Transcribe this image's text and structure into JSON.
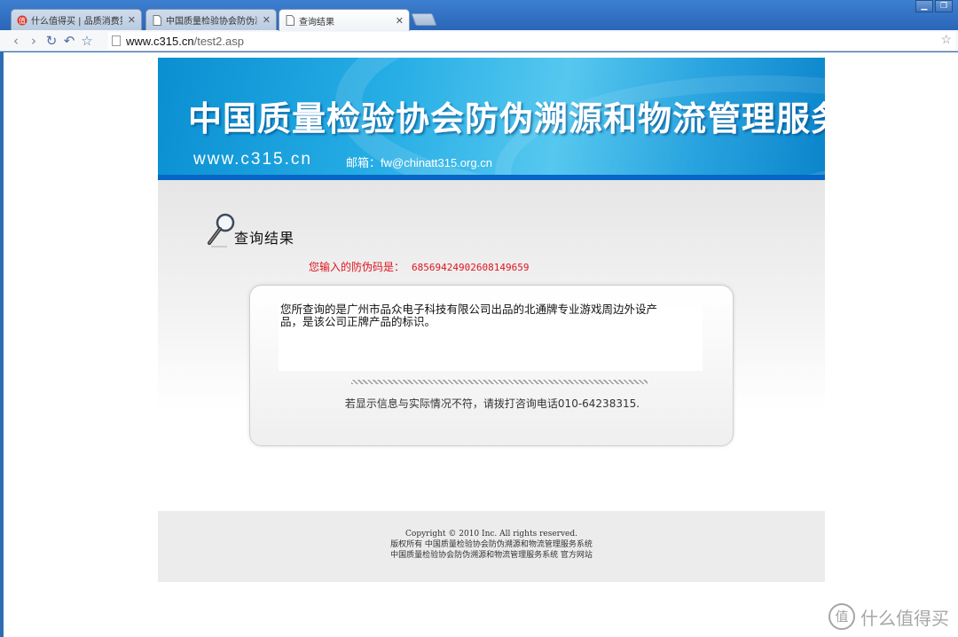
{
  "browser": {
    "tabs": [
      {
        "title": "什么值得买 | 品质消费第一",
        "active": false
      },
      {
        "title": "中国质量检验协会防伪溯源",
        "active": false
      },
      {
        "title": "查询结果",
        "active": true
      }
    ],
    "address": {
      "host": "www.c315.cn",
      "path": "/test2.asp"
    }
  },
  "banner": {
    "title": "中国质量检验协会防伪溯源和物流管理服务系统",
    "website": "www.c315.cn",
    "email_label": "邮箱：fw@chinatt315.org.cn"
  },
  "result": {
    "heading": "查询结果",
    "code_label": "您输入的防伪码是：",
    "code_value": "68569424902608149659",
    "message": "您所查询的是广州市品众电子科技有限公司出品的北通牌专业游戏周边外设产品，是该公司正牌产品的标识。",
    "contact": "若显示信息与实际情况不符，请拨打咨询电话010-64238315."
  },
  "footer": {
    "copyright": "Copyright © 2010 Inc. All rights reserved.",
    "rights": "版权所有   中国质量检验协会防伪溯源和物流管理服务系统",
    "official": "中国质量检验协会防伪溯源和物流管理服务系统 官方网站"
  },
  "watermark": {
    "text": "什么值得买",
    "logo": "值"
  },
  "colors": {
    "banner": "#27aee5",
    "code_red": "#e0141e",
    "footer_bg": "#ececec"
  }
}
